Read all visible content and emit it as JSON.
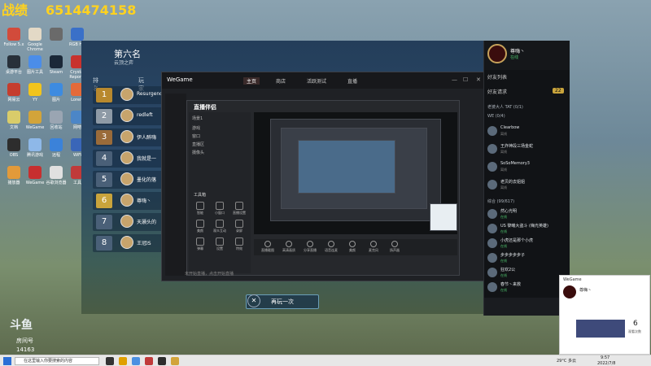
{
  "stream": {
    "score_label": "战绩",
    "score_value": "6514474158"
  },
  "desktop_icons": [
    {
      "label": "Follow 5.x",
      "color": "#d24b3b"
    },
    {
      "label": "Google Chrome",
      "color": "#e3d9c6"
    },
    {
      "label": "",
      "color": "#6a6a6a"
    },
    {
      "label": "RGB HD",
      "color": "#3a70c8"
    },
    {
      "label": "桌游平台",
      "color": "#28303a"
    },
    {
      "label": "图片工具",
      "color": "#4b8de8"
    },
    {
      "label": "Steam",
      "color": "#1b2838"
    },
    {
      "label": "Crystal Reports",
      "color": "#c8322e"
    },
    {
      "label": "网易云",
      "color": "#c53d2e"
    },
    {
      "label": "YY",
      "color": "#f2c41d"
    },
    {
      "label": "图片",
      "color": "#3d8be0"
    },
    {
      "label": "Lorem",
      "color": "#e46a3a"
    },
    {
      "label": "文档",
      "color": "#d9cc6a"
    },
    {
      "label": "WeGame",
      "color": "#d2a43a"
    },
    {
      "label": "回收站",
      "color": "#9aa5b2"
    },
    {
      "label": "网吧",
      "color": "#4c86c7"
    },
    {
      "label": "OBS",
      "color": "#2d2d2d"
    },
    {
      "label": "腾讯游戏",
      "color": "#8eb8e8"
    },
    {
      "label": "远程",
      "color": "#3b82d9"
    },
    {
      "label": "WiFi",
      "color": "#3a66b8"
    },
    {
      "label": "播放器",
      "color": "#e29a3a"
    },
    {
      "label": "WeGame",
      "color": "#c72f2f"
    },
    {
      "label": "谷歌浏览器",
      "color": "#e0e0e0"
    },
    {
      "label": "工具",
      "color": "#c03a3a"
    }
  ],
  "game": {
    "place_title": "第六名",
    "place_subtitle": "云顶之弈",
    "col_rank": "排名",
    "col_player": "玩家",
    "rows": [
      {
        "rank": "1",
        "name": "Resurgence",
        "color": "#b8892e"
      },
      {
        "rank": "2",
        "name": "redleft",
        "color": "#8e9aa6"
      },
      {
        "rank": "3",
        "name": "伊人醉嗨",
        "color": "#9a6b3a"
      },
      {
        "rank": "4",
        "name": "我就是一",
        "color": "#4a6078"
      },
      {
        "rank": "5",
        "name": "墨化的落",
        "color": "#4a6078"
      },
      {
        "rank": "6",
        "name": "尊嗨丶",
        "color": "#c9a43c"
      },
      {
        "rank": "7",
        "name": "天灏头的",
        "color": "#4a6078"
      },
      {
        "rank": "8",
        "name": "王冠IS",
        "color": "#4a6078"
      }
    ],
    "play_again": "再玩一次"
  },
  "wegame": {
    "logo": "WeGame",
    "tabs": [
      "主页",
      "商店",
      "活跃测试",
      "直播"
    ],
    "inner_title": "直播伴侣",
    "inner_rows": [
      "场景1",
      "游戏",
      "窗口",
      "直播区",
      "摄像头"
    ],
    "tools_label": "工具箱",
    "tools": [
      "智能",
      "小窗口",
      "直播设置",
      "美颜",
      "观众互动",
      "录屏",
      "弹幕",
      "设置",
      "特效"
    ],
    "bottom_buttons": [
      "直播截图",
      "高清画质",
      "分享直播",
      "语音连麦",
      "美颜",
      "麦克风",
      "扬声器"
    ],
    "footer": "未开始直播，点击开始直播"
  },
  "friends": {
    "name": "尊嗨丶",
    "status": "在线",
    "requests": "好友请求",
    "requests_count": "22",
    "friend_list": "好友列表",
    "groups": [
      {
        "label": "老婆大人 TAT (0/1)"
      },
      {
        "label": "WE (0/4)"
      },
      {
        "label": "综合 (99/617)"
      }
    ],
    "items": [
      {
        "name": "Clearbow",
        "status": "离线"
      },
      {
        "name": "王炸神段三场金蛇",
        "status": "离线"
      },
      {
        "name": "SoSoMemory3",
        "status": "离线"
      },
      {
        "name": "老贝的去姐姐",
        "status": "离线"
      },
      {
        "name": "然心光明",
        "status": "在线"
      },
      {
        "name": "US 黎曦大盗斗 (嗨光英雄)",
        "status": "在线"
      },
      {
        "name": "小虎还是那个小虎",
        "status": "在线"
      },
      {
        "name": "步步步步步子",
        "status": "在线"
      },
      {
        "name": "狂欢2公",
        "status": "在线"
      },
      {
        "name": "春节丶来救",
        "status": "在线"
      }
    ]
  },
  "popup": {
    "header": "WeGame",
    "user": "尊嗨丶",
    "count": "6",
    "count_label": "观看次数"
  },
  "douyu": {
    "logo": "斗鱼",
    "room_label": "房间号",
    "room_number": "14163"
  },
  "taskbar": {
    "search_placeholder": "在这里输入你要搜索的内容",
    "weather": "29°C 多云",
    "time": "9:57",
    "date": "2022/7/8"
  }
}
